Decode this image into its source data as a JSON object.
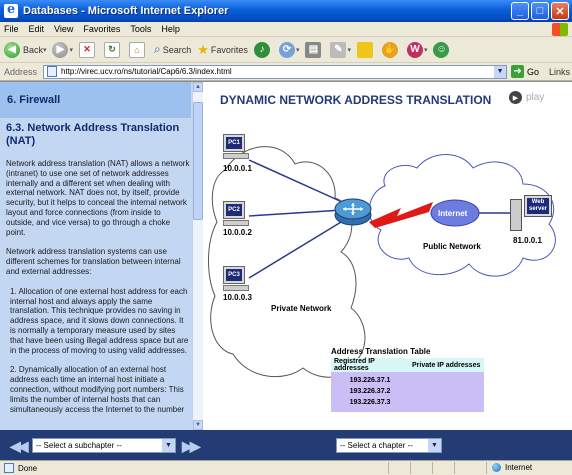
{
  "window": {
    "title": "Databases - Microsoft Internet Explorer",
    "buttons": [
      "_",
      "□",
      "✕"
    ]
  },
  "menu": [
    "File",
    "Edit",
    "View",
    "Favorites",
    "Tools",
    "Help"
  ],
  "toolbar": {
    "back": "Back",
    "search": "Search",
    "favorites": "Favorites"
  },
  "address": {
    "label": "Address",
    "url": "http://virec.ucv.ro/ns/tutorial/Cap6/6.3/index.html",
    "go": "Go",
    "links": "Links"
  },
  "left": {
    "chapter": "6.   Firewall",
    "section": "6.3. Network Address Translation (NAT)",
    "paragraphs": [
      "Network address translation (NAT) allows a network (intranet) to use one set of network addresses internally and a different set when dealing with external network. NAT does not, by itself, provide security, but it helps to conceal the internal network layout and force connections (from inside to outside, and vice versa) to go through a choke point.",
      "Network address translation systems can use different schemes for translation between internal and external addresses:",
      "1. Allocation of one external host address for each internal host and always apply the same translation. This technique provides no saving in address space, and it slows down connections. It is normally a temporary measure used by sites that have been using illegal address space but are in the process of moving to using valid addresses.",
      "2. Dynamically allocation of an external host address each time an internal host initiate a connection, without modifying port numbers: This limits the number of internal hosts that can simultaneously access the Internet to the number"
    ]
  },
  "diagram": {
    "title": "DYNAMIC NETWORK ADDRESS TRANSLATION",
    "play": "play",
    "pcs": [
      {
        "name": "PC1",
        "ip": "10.0.0.1"
      },
      {
        "name": "PC2",
        "ip": "10.0.0.2"
      },
      {
        "name": "PC3",
        "ip": "10.0.0.3"
      }
    ],
    "private_network": "Private Network",
    "internet": "Internet",
    "public_network": "Public Network",
    "server": {
      "line1": "Web",
      "line2": "server",
      "ip": "81.0.0.1"
    },
    "table": {
      "title": "Address Translation Table",
      "headers": [
        "Registred IP addresses",
        "Private IP addresses"
      ],
      "rows": [
        "193.226.37.1",
        "193.226.37.2",
        "193.226.37.3"
      ]
    }
  },
  "nav": {
    "subchapter": "-- Select a subchapter --",
    "chapter": "-- Select a chapter --"
  },
  "status": {
    "text": "Done",
    "zone": "Internet"
  }
}
